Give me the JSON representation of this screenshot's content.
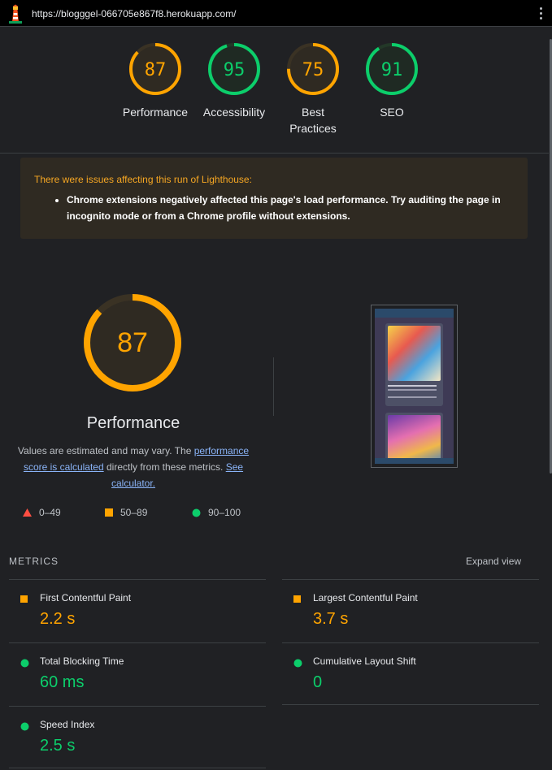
{
  "browser": {
    "url": "https://blogggel-066705e867f8.herokuapp.com/"
  },
  "scores": [
    {
      "value": "87",
      "label": "Performance",
      "color": "#ffa400",
      "fraction": 0.87
    },
    {
      "value": "95",
      "label": "Accessibility",
      "color": "#0cce6b",
      "fraction": 0.95
    },
    {
      "value": "75",
      "label": "Best Practices",
      "color": "#ffa400",
      "fraction": 0.75
    },
    {
      "value": "91",
      "label": "SEO",
      "color": "#0cce6b",
      "fraction": 0.91
    }
  ],
  "warning": {
    "title": "There were issues affecting this run of Lighthouse:",
    "item": "Chrome extensions negatively affected this page's load performance. Try auditing the page in incognito mode or from a Chrome profile without extensions."
  },
  "performance": {
    "score": "87",
    "fraction": 0.87,
    "title": "Performance",
    "note_before": "Values are estimated and may vary. The ",
    "note_link1": "performance score is calculated",
    "note_middle": " directly from these metrics. ",
    "note_link2": "See calculator."
  },
  "legend": [
    {
      "range": "0–49",
      "shape": "triangle",
      "color": "#ff4e42"
    },
    {
      "range": "50–89",
      "shape": "square",
      "color": "#ffa400"
    },
    {
      "range": "90–100",
      "shape": "circle",
      "color": "#0cce6b"
    }
  ],
  "metrics": {
    "header": "METRICS",
    "expand_label": "Expand view",
    "items": [
      {
        "name": "First Contentful Paint",
        "value": "2.2 s",
        "status": "average"
      },
      {
        "name": "Largest Contentful Paint",
        "value": "3.7 s",
        "status": "average"
      },
      {
        "name": "Total Blocking Time",
        "value": "60 ms",
        "status": "good"
      },
      {
        "name": "Cumulative Layout Shift",
        "value": "0",
        "status": "good"
      },
      {
        "name": "Speed Index",
        "value": "2.5 s",
        "status": "good"
      }
    ]
  },
  "colors": {
    "average": "#ffa400",
    "good": "#0cce6b",
    "fail": "#ff4e42"
  }
}
